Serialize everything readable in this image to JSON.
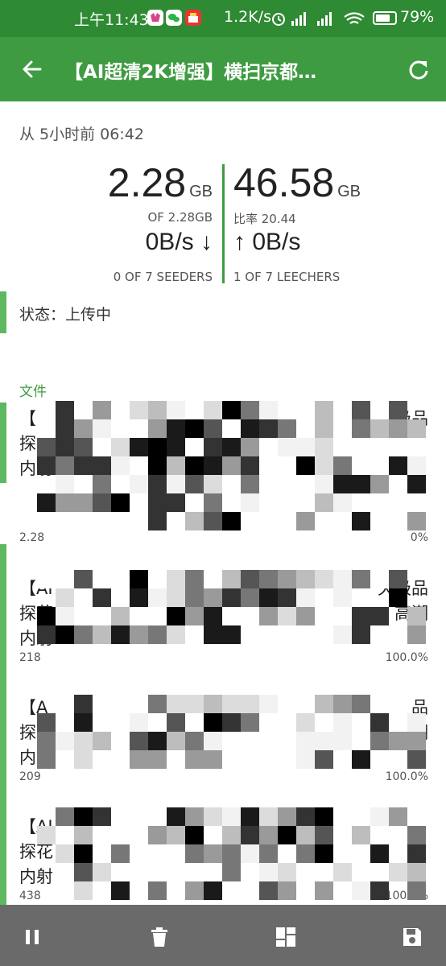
{
  "status_bar": {
    "time": "上午11:43",
    "network_speed": "1.2K/s",
    "battery": "79%",
    "battery_level": 0.79,
    "notification_icons": [
      "app-icon-1",
      "wechat-icon",
      "app-icon-3"
    ],
    "system_icons": [
      "alarm-icon",
      "signal-hd-icon",
      "signal-hd-icon",
      "wifi-icon",
      "battery-icon"
    ]
  },
  "app_bar": {
    "title": "【AI超清2K增强】横扫京都…",
    "back_icon": "arrow-left-icon",
    "refresh_icon": "refresh-icon"
  },
  "summary": {
    "since": "从 5小时前 06:42",
    "downloaded": {
      "value": "2.28",
      "unit": "GB"
    },
    "uploaded": {
      "value": "46.58",
      "unit": "GB"
    },
    "of_total": "OF 2.28GB",
    "ratio": "比率 20.44",
    "download_rate": "0B/s ↓",
    "upload_rate": "↑ 0B/s",
    "seeders": "0 OF 7 SEEDERS",
    "leechers": "1 OF 7 LEECHERS"
  },
  "status_text": "状态：上传中",
  "files_label": "文件",
  "files": [
    {
      "lines": [
        "【",
        "探",
        "内射"
      ],
      "tail": [
        "极品",
        "",
        ""
      ],
      "size": "2.28",
      "percent": "0%"
    },
    {
      "lines": [
        "【AI",
        "探花",
        "内射"
      ],
      "tail": [
        "天极品",
        "高潮",
        ""
      ],
      "size": "218",
      "percent": "100.0%"
    },
    {
      "lines": [
        "【A",
        "探",
        "内"
      ],
      "tail": [
        "品",
        "潮",
        ""
      ],
      "size": "209",
      "percent": "100.0%"
    },
    {
      "lines": [
        "【AI",
        "探花",
        "内射"
      ],
      "tail": [
        "",
        "",
        ""
      ],
      "size": "438",
      "percent": "100.0%"
    }
  ],
  "bottom_bar": {
    "buttons": [
      "pause-icon",
      "delete-icon",
      "dashboard-icon",
      "save-icon"
    ]
  },
  "colors": {
    "status_bar": "#2f8a34",
    "app_bar": "#3e9b41",
    "accent": "#5db860",
    "bottom_bar": "#6a6a6a"
  }
}
